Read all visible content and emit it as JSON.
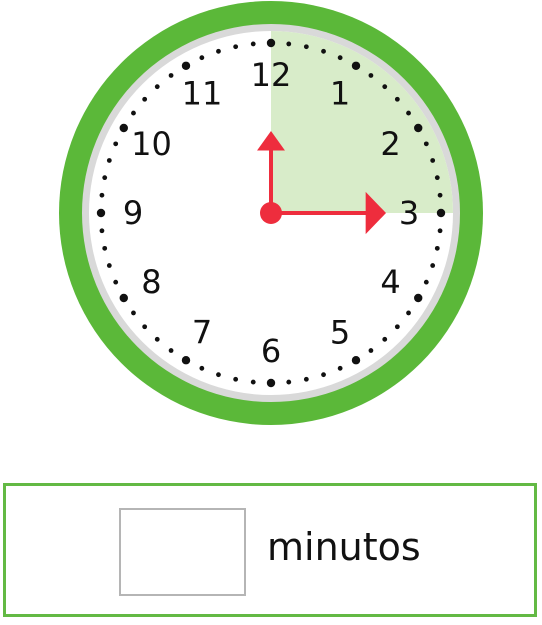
{
  "clock": {
    "numbers": [
      "12",
      "1",
      "2",
      "3",
      "4",
      "5",
      "6",
      "7",
      "8",
      "9",
      "10",
      "11"
    ],
    "hour_hand_points_to": 12,
    "minute_hand_points_to": 3,
    "shaded_sector": "12-3",
    "colors": {
      "rim": "#5bb839",
      "face": "#ffffff",
      "inner_ring": "#d9d9d9",
      "shaded": "#d8ecc9",
      "hands": "#ee2d3d"
    }
  },
  "answer": {
    "value": "",
    "label": "minutos"
  }
}
